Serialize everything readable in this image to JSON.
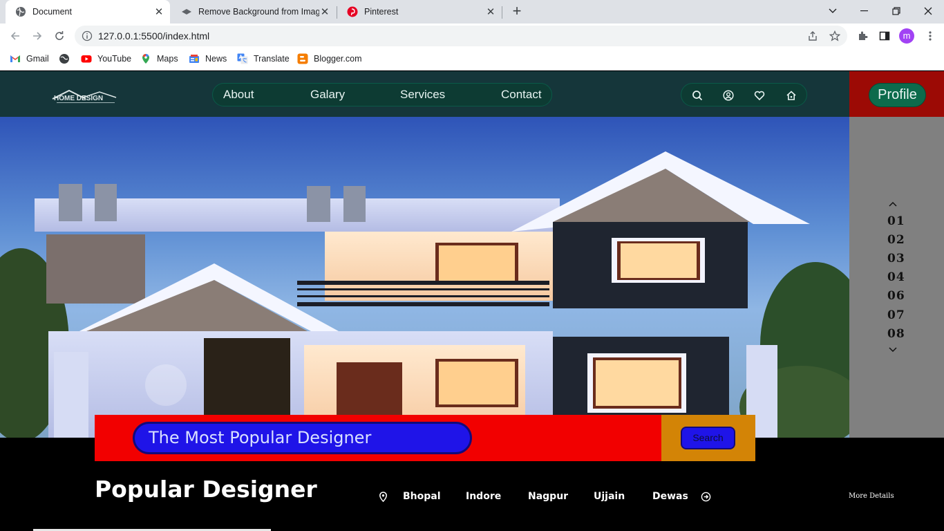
{
  "browser": {
    "tabs": [
      {
        "title": "Document",
        "active": true,
        "icon": "globe-icon"
      },
      {
        "title": "Remove Background from Image",
        "active": false,
        "icon": "layers-icon"
      },
      {
        "title": "Pinterest",
        "active": false,
        "icon": "pinterest-icon"
      }
    ],
    "url": "127.0.0.1:5500/index.html",
    "profile_initial": "m",
    "bookmarks": [
      {
        "label": "Gmail",
        "icon": "gmail-icon"
      },
      {
        "label": "YouTube",
        "icon": "youtube-icon"
      },
      {
        "label": "Maps",
        "icon": "maps-icon"
      },
      {
        "label": "News",
        "icon": "news-icon"
      },
      {
        "label": "Translate",
        "icon": "translate-icon"
      },
      {
        "label": "Blogger.com",
        "icon": "blogger-icon"
      }
    ]
  },
  "site": {
    "nav": [
      "About",
      "Galary",
      "Services",
      "Contact"
    ],
    "header_icons": [
      "search-icon",
      "user-icon",
      "heart-icon",
      "home-icon"
    ],
    "logo_text": "HOME DESIGN",
    "profile_label": "Profile",
    "side_numbers": [
      "01",
      "02",
      "03",
      "04",
      "06",
      "07",
      "08"
    ],
    "banner_text": "The Most Popular Designer",
    "search_label": "Search",
    "popular_title": "Popular Designer",
    "cities": [
      "Bhopal",
      "Indore",
      "Nagpur",
      "Ujjain",
      "Dewas"
    ],
    "more_details": "More Details"
  },
  "colors": {
    "header_bg": "#15363a",
    "profile_bg": "#9c0a05",
    "banner_red": "#f20000",
    "search_orange": "#d38406",
    "input_blue": "#1f14e8",
    "side_grey": "#808080"
  }
}
